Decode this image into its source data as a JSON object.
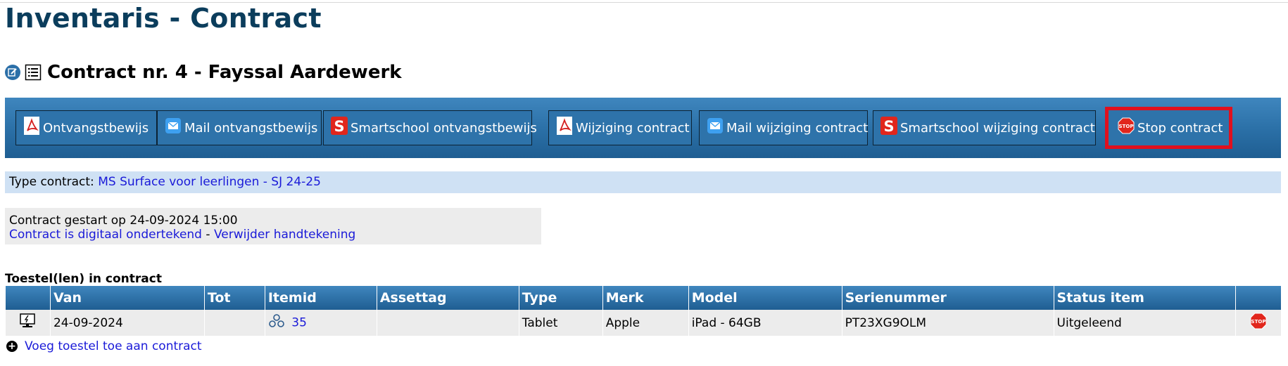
{
  "page": {
    "title": "Inventaris - Contract"
  },
  "contract": {
    "heading": "Contract nr. 4 - Fayssal Aardewerk"
  },
  "toolbar": {
    "buttons": [
      {
        "label": "Ontvangstbewijs",
        "icon": "pdf-icon"
      },
      {
        "label": "Mail ontvangstbewijs",
        "icon": "mail-icon"
      },
      {
        "label": "Smartschool ontvangstbewijs",
        "icon": "smartschool-icon"
      },
      {
        "label": "Wijziging contract",
        "icon": "pdf-icon"
      },
      {
        "label": "Mail wijziging contract",
        "icon": "mail-icon"
      },
      {
        "label": "Smartschool wijziging contract",
        "icon": "smartschool-icon"
      },
      {
        "label": "Stop contract",
        "icon": "stop-icon"
      }
    ]
  },
  "type_contract": {
    "label": "Type contract:",
    "value": "MS Surface voor leerlingen - SJ 24-25"
  },
  "info": {
    "started": "Contract gestart op 24-09-2024 15:00",
    "signed_link": "Contract is digitaal ondertekend",
    "separator": "-",
    "remove_signature_link": "Verwijder handtekening"
  },
  "devices": {
    "section_label": "Toestel(len) in contract",
    "columns": [
      "",
      "Van",
      "Tot",
      "Itemid",
      "Assettag",
      "Type",
      "Merk",
      "Model",
      "Serienummer",
      "Status item",
      ""
    ],
    "rows": [
      {
        "van": "24-09-2024",
        "tot": "",
        "itemid": "35",
        "assettag": "",
        "type": "Tablet",
        "merk": "Apple",
        "model": "iPad - 64GB",
        "serienummer": "PT23XG9OLM",
        "status": "Uitgeleend"
      }
    ],
    "add_link": "Voeg toestel toe aan contract"
  },
  "colors": {
    "title": "#0b3d5c",
    "toolbar": "#2a6fa6",
    "link": "#1a1ad8",
    "stop_highlight": "#e0101e",
    "type_row": "#cfe1f4"
  }
}
